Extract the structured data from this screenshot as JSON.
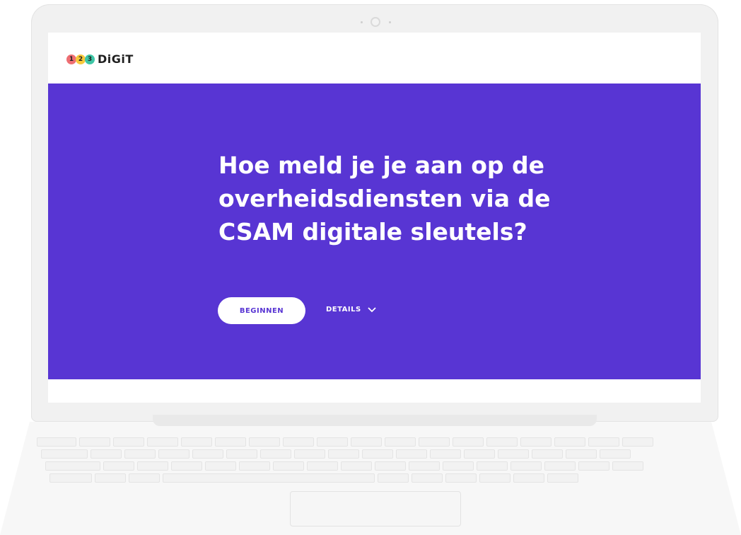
{
  "brand": {
    "digits": [
      "1",
      "2",
      "3"
    ],
    "name": "DiGiT",
    "colors": {
      "one": "#ee6e73",
      "two": "#f8c93c",
      "three": "#3ec6a6"
    }
  },
  "hero": {
    "title": "Hoe meld je je aan op de overheidsdiensten via de CSAM digitale sleutels?",
    "background": "#5835d3",
    "start_button": "BEGINNEN",
    "details_label": "DETAILS"
  },
  "icons": {
    "details": "chevron-down-icon"
  }
}
